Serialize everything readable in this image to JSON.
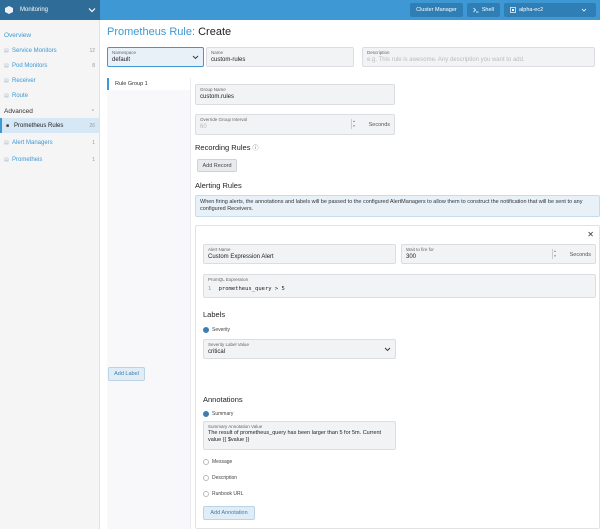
{
  "topbar": {
    "cluster_name": "Monitoring",
    "cluster_manager_label": "Cluster Manager",
    "shell_label": "Shell",
    "namespace_value": "alpha-ec2"
  },
  "sidebar": {
    "overview": "Overview",
    "items": [
      {
        "label": "Service Monitors",
        "count": "12"
      },
      {
        "label": "Pod Monitors",
        "count": "8"
      },
      {
        "label": "Receiver",
        "count": ""
      },
      {
        "label": "Route",
        "count": ""
      }
    ],
    "advanced_label": "Advanced",
    "advanced_items": [
      {
        "label": "Prometheus Rules",
        "count": "26"
      },
      {
        "label": "Alert Managers",
        "count": "1"
      },
      {
        "label": "Prometheis",
        "count": "1"
      }
    ]
  },
  "page": {
    "title_prefix": "Prometheus Rule:",
    "title_action": "Create"
  },
  "form": {
    "namespace_label": "Namespace",
    "namespace_value": "default",
    "name_label": "Name",
    "name_value": "custom-rules",
    "description_label": "Description",
    "description_placeholder": "e.g. This rule is awesome. Any description you want to add."
  },
  "tabs": [
    "Rule Group 1"
  ],
  "group": {
    "name_label": "Group Name",
    "name_value": "custom.rules",
    "interval_label": "Override Group Interval",
    "interval_value": "60",
    "interval_unit": "Seconds"
  },
  "recording": {
    "heading": "Recording Rules",
    "add_button": "Add Record"
  },
  "alerting": {
    "heading": "Alerting Rules",
    "info": "When firing alerts, the annotations and labels will be passed to the configured AlertManagers to allow them to construct the notification that will be sent to any configured Receivers.",
    "alert_name_label": "Alert Name",
    "alert_name_value": "Custom Expression Alert",
    "wait_label": "Wait to fire for",
    "wait_value": "300",
    "wait_unit": "Seconds",
    "promql_label": "PromQL Expression",
    "promql_line_number": "1",
    "promql_value": "prometheus_query > 5"
  },
  "labels": {
    "heading": "Labels",
    "severity_checkbox": "Severity",
    "severity_field_label": "Severity Label Value",
    "severity_value": "critical",
    "add_button": "Add Label"
  },
  "annotations": {
    "heading": "Annotations",
    "summary_checkbox": "Summary",
    "summary_field_label": "Summary Annotation Value",
    "summary_value": "The result of prometheus_query has been larger than 5 for 5m. Current value {{ $value }}",
    "message_checkbox": "Message",
    "description_checkbox": "Description",
    "runbook_checkbox": "Runbook URL",
    "add_button": "Add Annotation"
  }
}
